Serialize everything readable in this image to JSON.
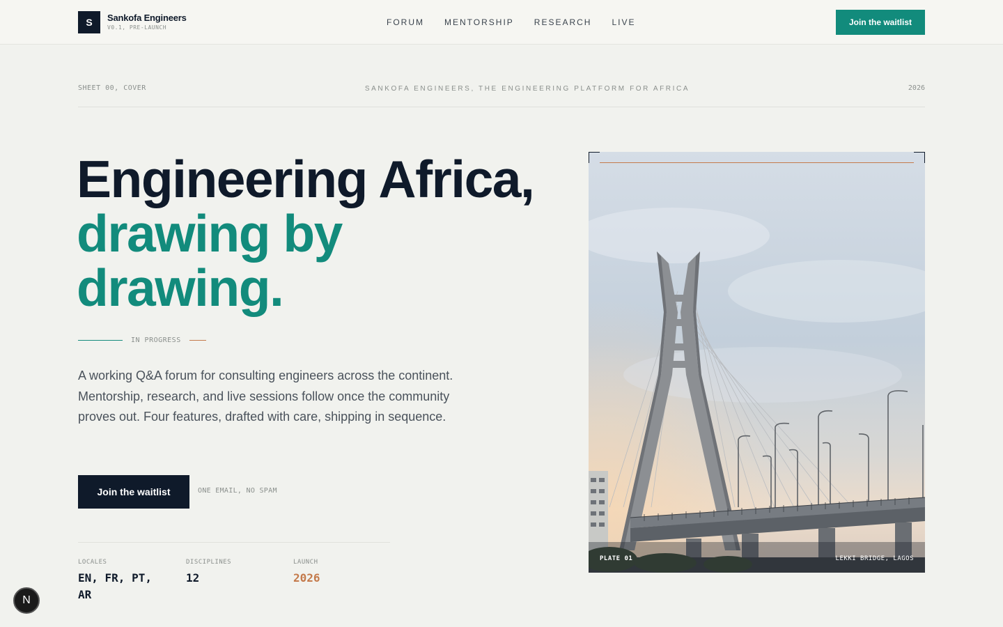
{
  "header": {
    "logo_letter": "S",
    "brand_name": "Sankofa Engineers",
    "version": "V0.1, PRE-LAUNCH",
    "nav": [
      "FORUM",
      "MENTORSHIP",
      "RESEARCH",
      "LIVE"
    ],
    "cta": "Join the waitlist"
  },
  "meta": {
    "left": "SHEET 00, COVER",
    "center": "SANKOFA ENGINEERS, THE ENGINEERING PLATFORM FOR AFRICA",
    "right": "2026"
  },
  "hero": {
    "headline_line1": "Engineering Africa,",
    "headline_line2": "drawing by",
    "headline_line3": "drawing.",
    "status": "IN PROGRESS",
    "description": "A working Q&A forum for consulting engineers across the continent. Mentorship, research, and live sessions follow once the community proves out. Four features, drafted with care, shipping in sequence.",
    "cta": "Join the waitlist",
    "cta_note": "ONE EMAIL, NO SPAM"
  },
  "stats": [
    {
      "label": "LOCALES",
      "value": "EN, FR, PT, AR"
    },
    {
      "label": "DISCIPLINES",
      "value": "12"
    },
    {
      "label": "LAUNCH",
      "value": "2026"
    }
  ],
  "figure": {
    "plate": "PLATE 01",
    "caption": "LEKKI BRIDGE, LAGOS"
  },
  "dev_badge": "N",
  "colors": {
    "accent": "#128b7c",
    "ink": "#0f1a2a",
    "copper": "#c47a4b",
    "background": "#f1f2ee"
  }
}
